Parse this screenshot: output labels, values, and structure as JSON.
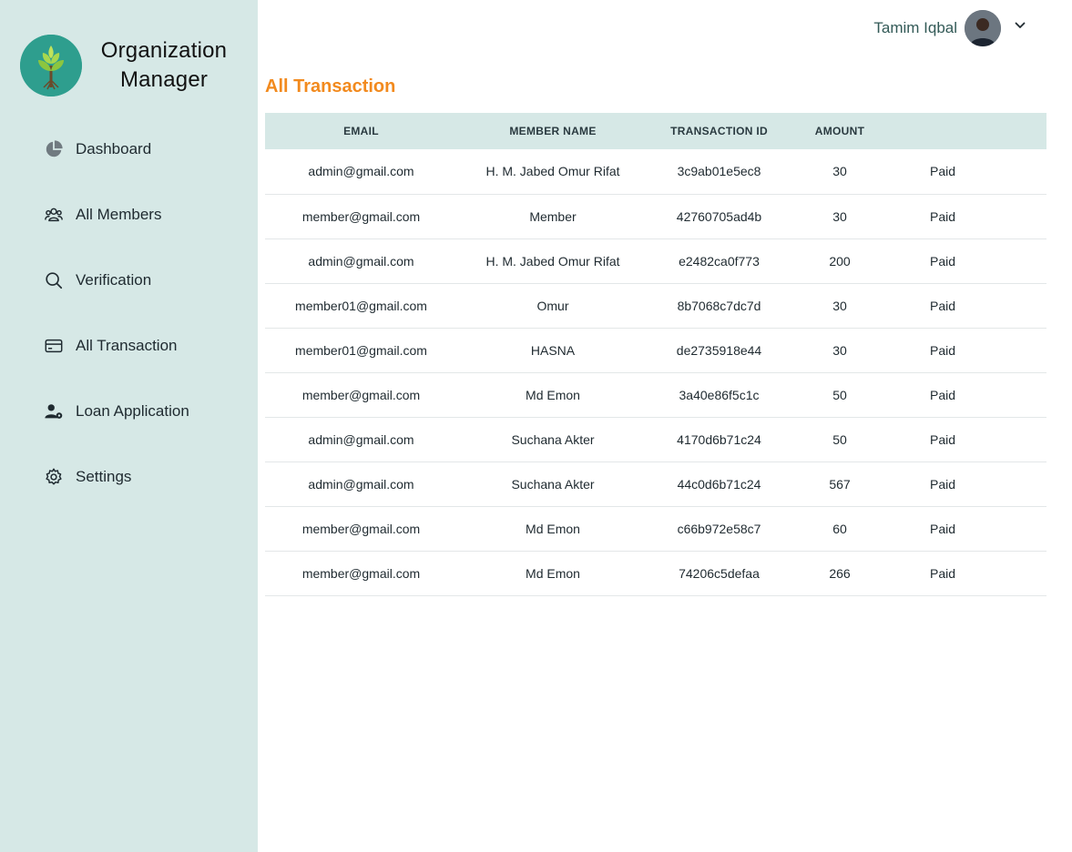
{
  "brand": {
    "name_line1": "Organization",
    "name_line2": "Manager"
  },
  "nav": [
    {
      "label": "Dashboard",
      "icon": "pie-chart-icon"
    },
    {
      "label": "All Members",
      "icon": "users-icon"
    },
    {
      "label": "Verification",
      "icon": "search-icon"
    },
    {
      "label": "All Transaction",
      "icon": "credit-card-icon"
    },
    {
      "label": "Loan Application",
      "icon": "user-gear-icon"
    },
    {
      "label": "Settings",
      "icon": "gear-icon"
    }
  ],
  "user": {
    "name": "Tamim Iqbal"
  },
  "page": {
    "title": "All Transaction"
  },
  "table": {
    "headers": [
      "EMAIL",
      "MEMBER NAME",
      "TRANSACTION ID",
      "AMOUNT",
      ""
    ],
    "rows": [
      {
        "email": "admin@gmail.com",
        "name": "H. M. Jabed Omur Rifat",
        "tx": "3c9ab01e5ec8",
        "amount": "30",
        "status": "Paid"
      },
      {
        "email": "member@gmail.com",
        "name": "Member",
        "tx": "42760705ad4b",
        "amount": "30",
        "status": "Paid"
      },
      {
        "email": "admin@gmail.com",
        "name": "H. M. Jabed Omur Rifat",
        "tx": "e2482ca0f773",
        "amount": "200",
        "status": "Paid"
      },
      {
        "email": "member01@gmail.com",
        "name": "Omur",
        "tx": "8b7068c7dc7d",
        "amount": "30",
        "status": "Paid"
      },
      {
        "email": "member01@gmail.com",
        "name": "HASNA",
        "tx": "de2735918e44",
        "amount": "30",
        "status": "Paid"
      },
      {
        "email": "member@gmail.com",
        "name": "Md Emon",
        "tx": "3a40e86f5c1c",
        "amount": "50",
        "status": "Paid"
      },
      {
        "email": "admin@gmail.com",
        "name": "Suchana Akter",
        "tx": "4170d6b71c24",
        "amount": "50",
        "status": "Paid"
      },
      {
        "email": "admin@gmail.com",
        "name": "Suchana Akter",
        "tx": "44c0d6b71c24",
        "amount": "567",
        "status": "Paid"
      },
      {
        "email": "member@gmail.com",
        "name": "Md Emon",
        "tx": "c66b972e58c7",
        "amount": "60",
        "status": "Paid"
      },
      {
        "email": "member@gmail.com",
        "name": "Md Emon",
        "tx": "74206c5defaa",
        "amount": "266",
        "status": "Paid"
      }
    ]
  },
  "colors": {
    "sidebar": "#d6e8e6",
    "accent": "#f28a1e",
    "green": "#2e9468",
    "red": "#e0241b"
  }
}
